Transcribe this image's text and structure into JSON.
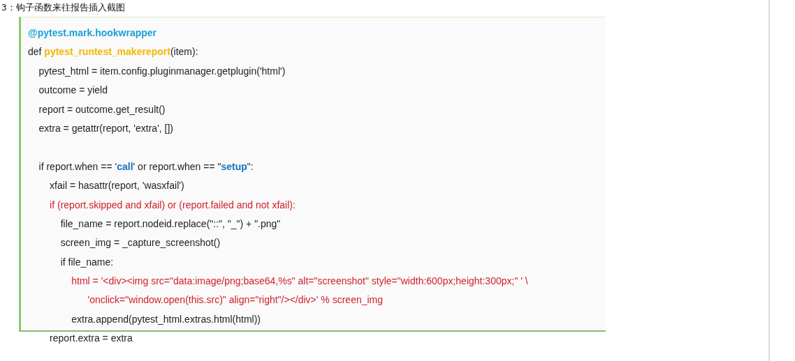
{
  "heading": "3：钩子函数来往报告插入截图",
  "code_lines": [
    {
      "kind": "code",
      "parts": [
        {
          "kind": "decorator",
          "text": "@pytest.mark.hookwrapper"
        }
      ]
    },
    {
      "kind": "code",
      "parts": [
        {
          "kind": "plain",
          "text": "def "
        },
        {
          "kind": "function",
          "text": "pytest_runtest_makereport"
        },
        {
          "kind": "plain",
          "text": "(item):"
        }
      ]
    },
    {
      "kind": "code",
      "parts": [
        {
          "kind": "plain",
          "text": "    pytest_html = item.config.pluginmanager.getplugin('html')"
        }
      ]
    },
    {
      "kind": "code",
      "parts": [
        {
          "kind": "plain",
          "text": "    outcome = yield"
        }
      ]
    },
    {
      "kind": "code",
      "parts": [
        {
          "kind": "plain",
          "text": "    report = outcome.get_result()"
        }
      ]
    },
    {
      "kind": "code",
      "parts": [
        {
          "kind": "plain",
          "text": "    extra = getattr(report, 'extra', [])"
        }
      ]
    },
    {
      "kind": "blank"
    },
    {
      "kind": "code",
      "parts": [
        {
          "kind": "plain",
          "text": "    if report.when == '"
        },
        {
          "kind": "string",
          "text": "call"
        },
        {
          "kind": "plain",
          "text": "' or report.when == \""
        },
        {
          "kind": "string",
          "text": "setup"
        },
        {
          "kind": "plain",
          "text": "\":"
        }
      ]
    },
    {
      "kind": "code",
      "parts": [
        {
          "kind": "plain",
          "text": "        xfail = hasattr(report, 'wasxfail')"
        }
      ]
    },
    {
      "kind": "code",
      "parts": [
        {
          "kind": "error",
          "text": "        if (report.skipped and xfail) or (report.failed and not xfail):"
        }
      ]
    },
    {
      "kind": "code",
      "parts": [
        {
          "kind": "plain",
          "text": "            file_name = report.nodeid.replace(\"::\", \"_\") + \".png\""
        }
      ]
    },
    {
      "kind": "code",
      "parts": [
        {
          "kind": "plain",
          "text": "            screen_img = _capture_screenshot()"
        }
      ]
    },
    {
      "kind": "code",
      "parts": [
        {
          "kind": "plain",
          "text": "            if file_name:"
        }
      ]
    },
    {
      "kind": "code",
      "parts": [
        {
          "kind": "error",
          "text": "                html = '<div><img src=\"data:image/png;base64,%s\" alt=\"screenshot\" style=\"width:600px;height:300px;\" ' \\"
        }
      ]
    },
    {
      "kind": "code",
      "parts": [
        {
          "kind": "error",
          "text": "                      'onclick=\"window.open(this.src)\" align=\"right\"/></div>' % screen_img"
        }
      ]
    },
    {
      "kind": "code",
      "parts": [
        {
          "kind": "plain",
          "text": "                extra.append(pytest_html.extras.html(html))"
        }
      ]
    },
    {
      "kind": "code",
      "parts": [
        {
          "kind": "plain",
          "text": "        report.extra = extra"
        }
      ]
    }
  ]
}
